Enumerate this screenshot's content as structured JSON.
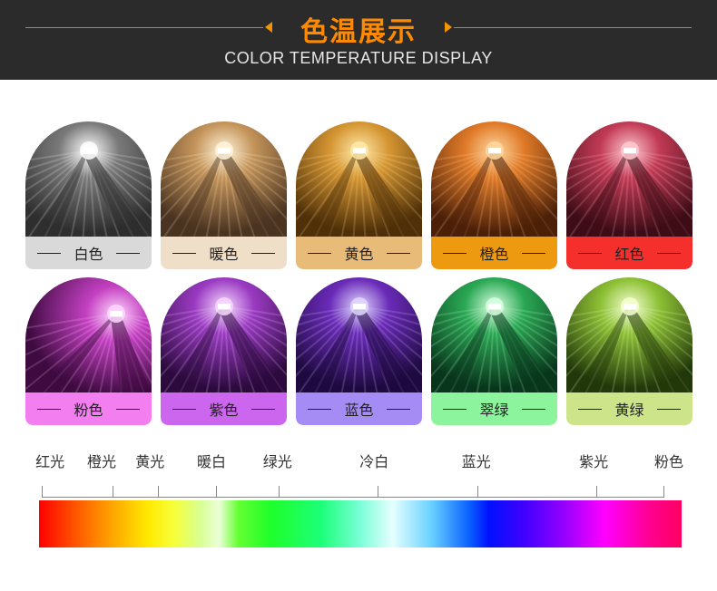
{
  "header": {
    "title": "色温展示",
    "subtitle": "COLOR TEMPERATURE DISPLAY",
    "accent_color": "#f29400"
  },
  "cards": [
    {
      "label": "白色",
      "bar_color": "#d9d9d9",
      "glow": "#ffffff",
      "tone": "#7a7a7a",
      "dark": "#2e2e2e"
    },
    {
      "label": "暖色",
      "bar_color": "#f0dfc8",
      "glow": "#fff3d8",
      "tone": "#c4945a",
      "dark": "#4a3320"
    },
    {
      "label": "黄色",
      "bar_color": "#e8bb79",
      "glow": "#ffe9a8",
      "tone": "#d59532",
      "dark": "#4f3008"
    },
    {
      "label": "橙色",
      "bar_color": "#ee9a10",
      "glow": "#ffd8a0",
      "tone": "#e07a28",
      "dark": "#4c2008"
    },
    {
      "label": "红色",
      "bar_color": "#f5302c",
      "glow": "#ffc8d0",
      "tone": "#c23a55",
      "dark": "#3e0c16"
    },
    {
      "label": "粉色",
      "bar_color": "#f27ef0",
      "glow": "#ffd8ff",
      "tone": "#c440c2",
      "dark": "#3e0a40"
    },
    {
      "label": "紫色",
      "bar_color": "#cc66ee",
      "glow": "#f6d8ff",
      "tone": "#9a3ac2",
      "dark": "#2c0a3e"
    },
    {
      "label": "蓝色",
      "bar_color": "#a48cf4",
      "glow": "#e0d8ff",
      "tone": "#6a2ab8",
      "dark": "#1e0a40"
    },
    {
      "label": "翠绿",
      "bar_color": "#8cf49c",
      "glow": "#d8ffe0",
      "tone": "#2aa854",
      "dark": "#08361c"
    },
    {
      "label": "黄绿",
      "bar_color": "#cde48a",
      "glow": "#f4ffd0",
      "tone": "#8cc034",
      "dark": "#22380a"
    }
  ],
  "scale": {
    "labels": [
      {
        "text": "红光",
        "pos": 0.028
      },
      {
        "text": "橙光",
        "pos": 0.107
      },
      {
        "text": "黄光",
        "pos": 0.181
      },
      {
        "text": "暖白",
        "pos": 0.275
      },
      {
        "text": "绿光",
        "pos": 0.376
      },
      {
        "text": "冷白",
        "pos": 0.524
      },
      {
        "text": "蓝光",
        "pos": 0.68
      },
      {
        "text": "紫光",
        "pos": 0.86
      },
      {
        "text": "粉色",
        "pos": 0.975
      }
    ],
    "ticks": [
      0,
      0.113,
      0.187,
      0.28,
      0.38,
      0.54,
      0.7,
      0.89,
      1.0
    ]
  }
}
